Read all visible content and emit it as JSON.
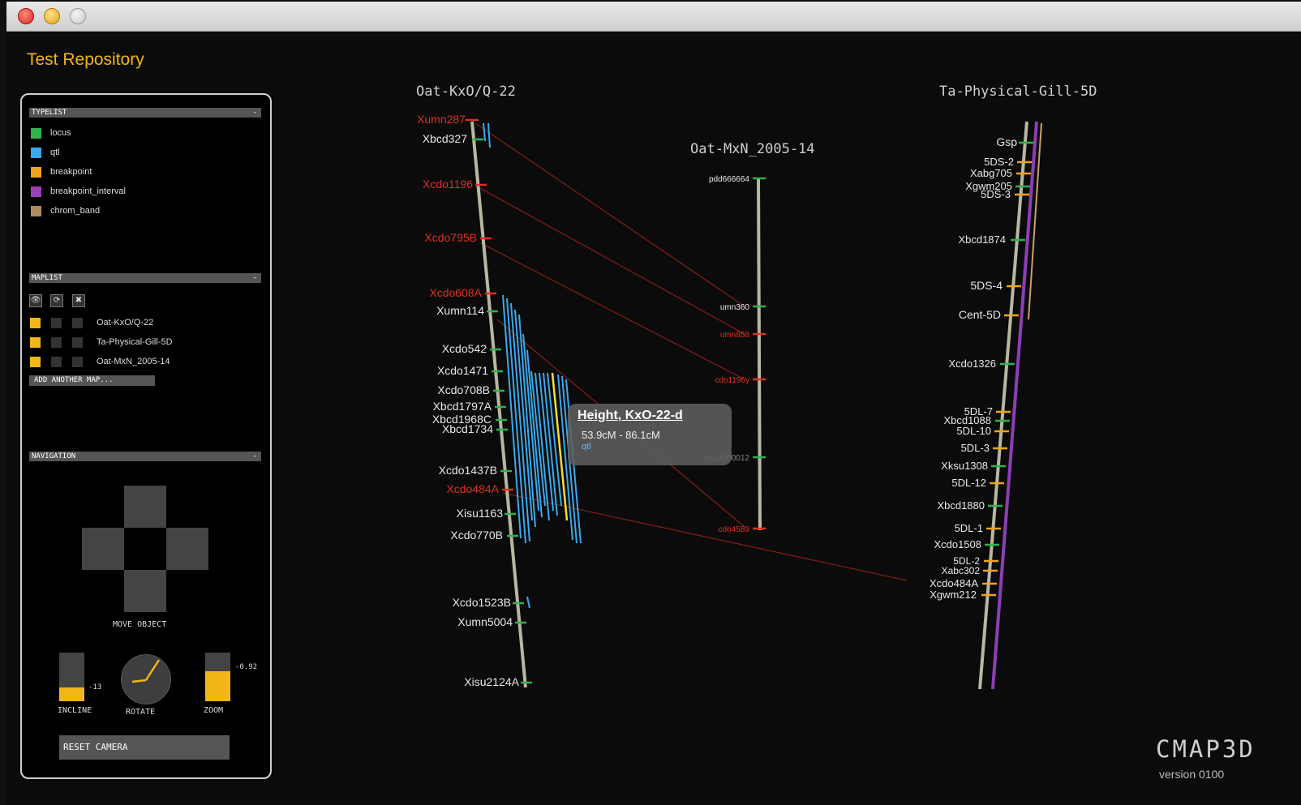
{
  "app": {
    "title": "Test Repository",
    "brand": "CMAP3D",
    "version": "version 0100"
  },
  "typelist": {
    "header": "TYPELIST",
    "collapse": "-",
    "items": [
      {
        "label": "locus",
        "color": "#2fb34a"
      },
      {
        "label": "qtl",
        "color": "#3aa9f0"
      },
      {
        "label": "breakpoint",
        "color": "#f2a31b"
      },
      {
        "label": "breakpoint_interval",
        "color": "#9b3fb5"
      },
      {
        "label": "chrom_band",
        "color": "#b08a5e"
      }
    ]
  },
  "maplist": {
    "header": "MAPLIST",
    "collapse": "-",
    "icons": [
      "eye-icon",
      "refresh-icon",
      "close-icon"
    ],
    "icon_glyphs": [
      "👁",
      "⟳",
      "✖"
    ],
    "maps": [
      {
        "label": "Oat-KxO/Q-22",
        "color": "#f2b619"
      },
      {
        "label": "Ta-Physical-Gill-5D",
        "color": "#f2b619"
      },
      {
        "label": "Oat-MxN_2005-14",
        "color": "#f2b619"
      }
    ],
    "add_label": "ADD ANOTHER MAP..."
  },
  "navigation": {
    "header": "NAVIGATION",
    "collapse": "-",
    "move_label": "MOVE OBJECT",
    "incline_label": "INCLINE",
    "incline_value": "-13",
    "incline_level": 0.28,
    "rotate_label": "ROTATE",
    "zoom_label": "ZOOM",
    "zoom_value": "-0.92",
    "zoom_level": 0.62,
    "reset_label": "RESET CAMERA"
  },
  "maps": {
    "left": {
      "title": "Oat-KxO/Q-22",
      "markers": [
        {
          "label": "Xumn287",
          "color": "#e0301e"
        },
        {
          "label": "Xbcd327",
          "color": "#e8e8e8"
        },
        {
          "label": "Xcdo1196",
          "color": "#e0301e"
        },
        {
          "label": "Xcdo795B",
          "color": "#e0301e"
        },
        {
          "label": "Xcdo608A",
          "color": "#e0301e"
        },
        {
          "label": "Xumn114",
          "color": "#e8e8e8"
        },
        {
          "label": "Xcdo542",
          "color": "#e8e8e8"
        },
        {
          "label": "Xcdo1471",
          "color": "#e8e8e8"
        },
        {
          "label": "Xcdo708B",
          "color": "#e8e8e8"
        },
        {
          "label": "Xbcd1797A",
          "color": "#e8e8e8"
        },
        {
          "label": "Xbcd1968C",
          "color": "#e8e8e8"
        },
        {
          "label": "Xbcd1734",
          "color": "#e8e8e8"
        },
        {
          "label": "Xcdo1437B",
          "color": "#e8e8e8"
        },
        {
          "label": "Xcdo484A",
          "color": "#e0301e"
        },
        {
          "label": "Xisu1163",
          "color": "#e8e8e8"
        },
        {
          "label": "Xcdo770B",
          "color": "#e8e8e8"
        },
        {
          "label": "Xcdo1523B",
          "color": "#e8e8e8"
        },
        {
          "label": "Xumn5004",
          "color": "#e8e8e8"
        },
        {
          "label": "Xisu2124A",
          "color": "#e8e8e8"
        }
      ]
    },
    "middle": {
      "title": "Oat-MxN_2005-14",
      "markers": [
        {
          "label": "pdd666664",
          "color": "#e8e8e8"
        },
        {
          "label": "umn360",
          "color": "#e8e8e8"
        },
        {
          "label": "umn858",
          "color": "#e0301e"
        },
        {
          "label": "cdo1196y",
          "color": "#e0301e"
        },
        {
          "label": "p41a000012",
          "color": "#888888"
        },
        {
          "label": "cdo4589",
          "color": "#e0301e"
        }
      ]
    },
    "right": {
      "title": "Ta-Physical-Gill-5D",
      "markers": [
        {
          "label": "Gsp",
          "color": "#e8e8e8"
        },
        {
          "label": "5DS-2",
          "color": "#e8e8e8"
        },
        {
          "label": "Xabg705",
          "color": "#e8e8e8"
        },
        {
          "label": "Xgwm205",
          "color": "#e8e8e8"
        },
        {
          "label": "5DS-3",
          "color": "#e8e8e8"
        },
        {
          "label": "Xbcd1874",
          "color": "#e8e8e8"
        },
        {
          "label": "5DS-4",
          "color": "#e8e8e8"
        },
        {
          "label": "Cent-5D",
          "color": "#e8e8e8"
        },
        {
          "label": "Xcdo1326",
          "color": "#e8e8e8"
        },
        {
          "label": "5DL-7",
          "color": "#e8e8e8"
        },
        {
          "label": "Xbcd1088",
          "color": "#e8e8e8"
        },
        {
          "label": "5DL-10",
          "color": "#e8e8e8"
        },
        {
          "label": "5DL-3",
          "color": "#e8e8e8"
        },
        {
          "label": "Xksu1308",
          "color": "#e8e8e8"
        },
        {
          "label": "5DL-12",
          "color": "#e8e8e8"
        },
        {
          "label": "Xbcd1880",
          "color": "#e8e8e8"
        },
        {
          "label": "5DL-1",
          "color": "#e8e8e8"
        },
        {
          "label": "Xcdo1508",
          "color": "#e8e8e8"
        },
        {
          "label": "5DL-2",
          "color": "#e8e8e8"
        },
        {
          "label": "Xabc302",
          "color": "#e8e8e8"
        },
        {
          "label": "Xcdo484A",
          "color": "#e8e8e8"
        },
        {
          "label": "Xgwm212",
          "color": "#e8e8e8"
        }
      ]
    }
  },
  "tooltip": {
    "title": "Height, KxO-22-d",
    "range": "53.9cM - 86.1cM",
    "type": "qtl"
  }
}
